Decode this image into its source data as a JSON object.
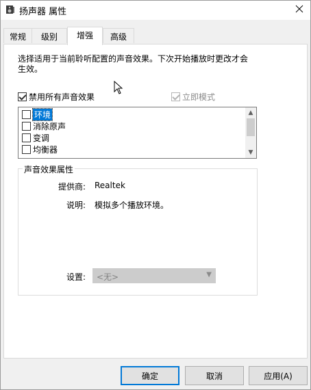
{
  "window": {
    "title": "扬声器 属性",
    "icon": "speaker-icon",
    "close_icon": "close-icon"
  },
  "tabs": [
    {
      "label": "常规",
      "active": false
    },
    {
      "label": "级别",
      "active": false
    },
    {
      "label": "增强",
      "active": true
    },
    {
      "label": "高级",
      "active": false
    }
  ],
  "panel": {
    "description": "选择适用于当前聆听配置的声音效果。下次开始播放时更改才会生效。",
    "disable_all": {
      "label": "禁用所有声音效果",
      "checked": true
    },
    "immediate_mode": {
      "label": "立即模式",
      "checked": true,
      "disabled": true
    },
    "effects": [
      {
        "label": "环境",
        "checked": false,
        "selected": true
      },
      {
        "label": "消除原声",
        "checked": false,
        "selected": false
      },
      {
        "label": "变调",
        "checked": false,
        "selected": false
      },
      {
        "label": "均衡器",
        "checked": false,
        "selected": false
      }
    ],
    "properties": {
      "group_title": "声音效果属性",
      "provider_label": "提供商:",
      "provider_value": "Realtek",
      "description_label": "说明:",
      "description_value": "模拟多个播放环境。",
      "settings_label": "设置:",
      "settings_value": "<无>"
    }
  },
  "buttons": {
    "ok": "确定",
    "cancel": "取消",
    "apply": "应用(A)"
  },
  "colors": {
    "accent": "#0078d7",
    "window_bg": "#f0f0f0",
    "panel_bg": "#ffffff",
    "disabled_text": "#8a8a8a"
  }
}
